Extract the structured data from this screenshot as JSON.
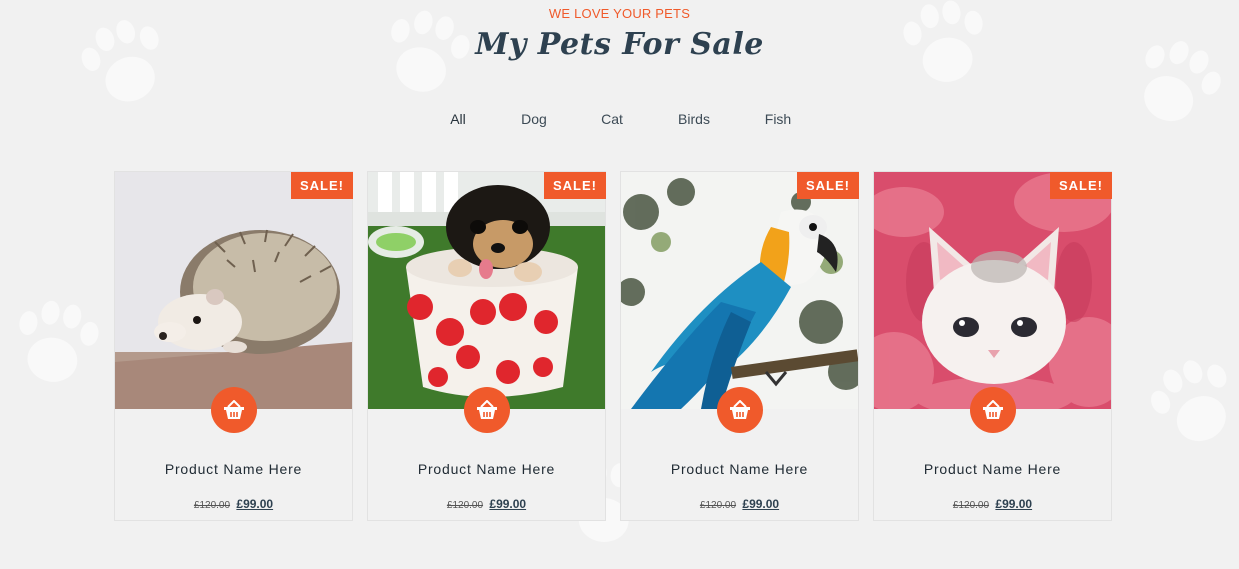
{
  "header": {
    "eyebrow": "WE LOVE YOUR PETS",
    "title": "My Pets For Sale"
  },
  "filters": [
    "All",
    "Dog",
    "Cat",
    "Birds",
    "Fish"
  ],
  "colors": {
    "accent": "#f05a2b",
    "heading": "#2e4150",
    "background": "#f1f1f1"
  },
  "products": [
    {
      "badge": "SALE!",
      "image": "hedgehog",
      "name": "Product Name Here",
      "old_price": "£120.00",
      "price": "£99.00",
      "icon": "basket-icon"
    },
    {
      "badge": "SALE!",
      "image": "puppy-in-cup",
      "name": "Product Name Here",
      "old_price": "£120.00",
      "price": "£99.00",
      "icon": "basket-icon"
    },
    {
      "badge": "SALE!",
      "image": "macaw-parrot",
      "name": "Product Name Here",
      "old_price": "£120.00",
      "price": "£99.00",
      "icon": "basket-icon"
    },
    {
      "badge": "SALE!",
      "image": "kitten-in-towel",
      "name": "Product Name Here",
      "old_price": "£120.00",
      "price": "£99.00",
      "icon": "basket-icon"
    }
  ]
}
